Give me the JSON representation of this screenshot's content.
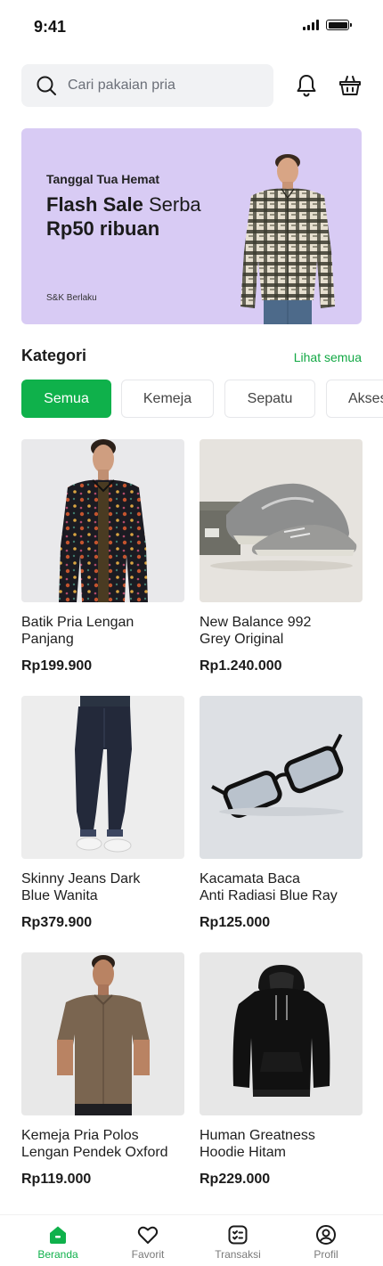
{
  "status": {
    "time": "9:41"
  },
  "search": {
    "placeholder": "Cari pakaian pria"
  },
  "banner": {
    "kicker": "Tanggal Tua Hemat",
    "title_bold": "Flash Sale",
    "title_regular": " Serba",
    "title_line2": "Rp50 ribuan",
    "terms": "S&K Berlaku"
  },
  "categories": {
    "title": "Kategori",
    "see_all": "Lihat semua",
    "chips": [
      "Semua",
      "Kemeja",
      "Sepatu",
      "Aksesoris"
    ],
    "active_index": 0
  },
  "products": [
    {
      "name": "Batik Pria Lengan\nPanjang",
      "price": "Rp199.900",
      "icon": "batik-shirt-photo"
    },
    {
      "name": "New Balance 992\nGrey Original",
      "price": "Rp1.240.000",
      "icon": "sneakers-photo"
    },
    {
      "name": "Skinny Jeans Dark\nBlue Wanita",
      "price": "Rp379.900",
      "icon": "jeans-photo"
    },
    {
      "name": "Kacamata Baca\nAnti Radiasi Blue Ray",
      "price": "Rp125.000",
      "icon": "glasses-photo"
    },
    {
      "name": "Kemeja Pria Polos\nLengan Pendek Oxford",
      "price": "Rp119.000",
      "icon": "oxford-shirt-photo"
    },
    {
      "name": "Human Greatness\nHoodie Hitam",
      "price": "Rp229.000",
      "icon": "hoodie-photo"
    }
  ],
  "nav": [
    {
      "label": "Beranda",
      "icon": "home-icon",
      "active": true
    },
    {
      "label": "Favorit",
      "icon": "heart-icon",
      "active": false
    },
    {
      "label": "Transaksi",
      "icon": "receipt-icon",
      "active": false
    },
    {
      "label": "Profil",
      "icon": "profile-icon",
      "active": false
    }
  ],
  "colors": {
    "accent": "#0FB14B",
    "banner_bg": "#D8CBF4",
    "search_bg": "#F1F2F4"
  }
}
